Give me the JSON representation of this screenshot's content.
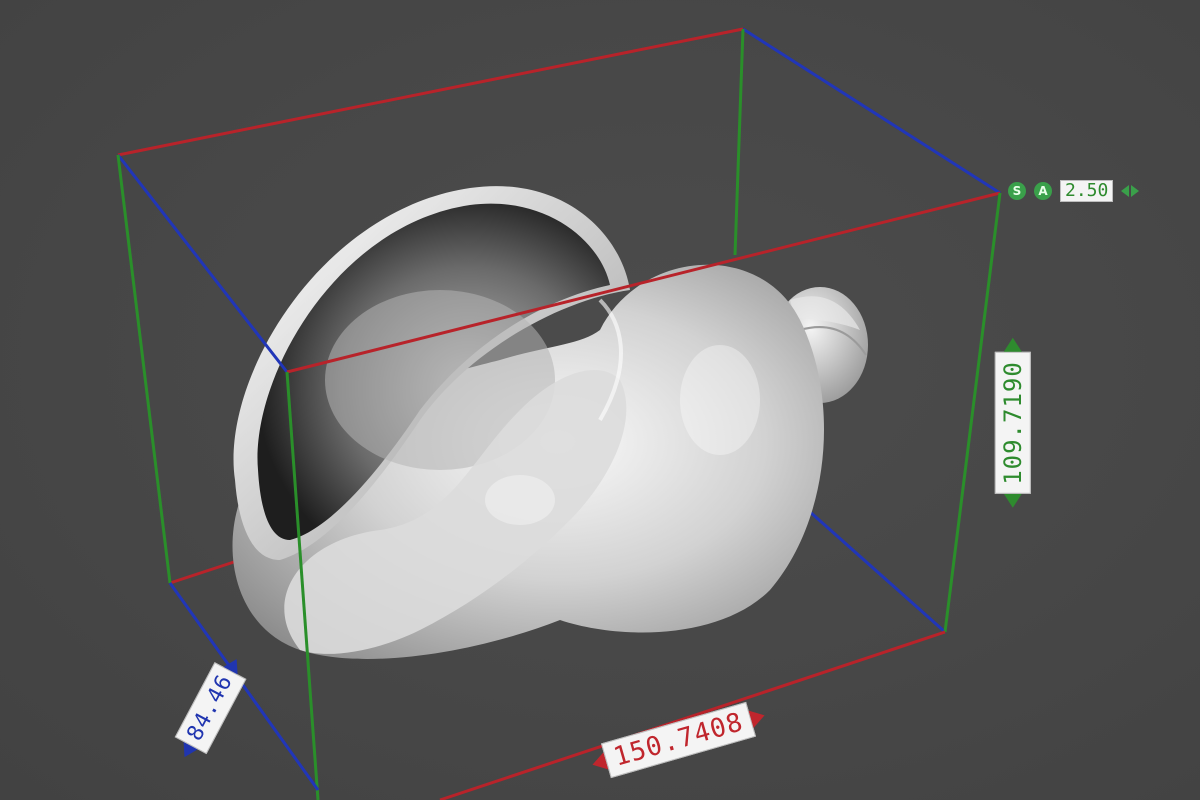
{
  "viewport": {
    "background": "#474747",
    "axis_colors": {
      "x": "#c0262d",
      "y": "#2e8b2e",
      "z": "#2035b0"
    }
  },
  "model": {
    "name_icon": "seashell-model"
  },
  "dimensions": {
    "width": "150.7408",
    "height": "109.7190",
    "depth": "84.46"
  },
  "gizmo": {
    "s_label": "S",
    "a_label": "A",
    "step_value": "2.50"
  }
}
